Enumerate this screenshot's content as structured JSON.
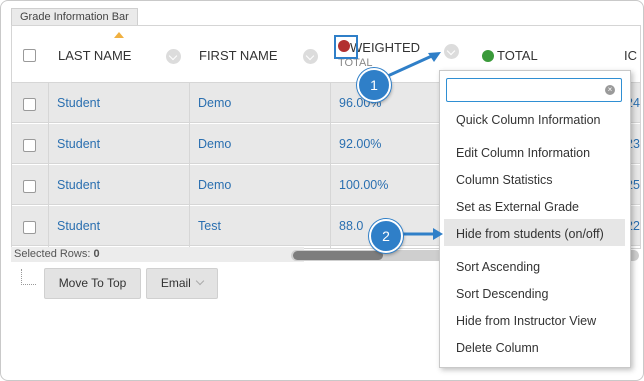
{
  "grade_bar": {
    "title": "Grade Information Bar"
  },
  "columns": {
    "last_name": "LAST NAME",
    "first_name": "FIRST NAME",
    "weighted": "WEIGHTED",
    "weighted_sub": "TOTAL",
    "total": "TOTAL",
    "ic": "IC"
  },
  "rows": [
    {
      "last": "Student",
      "first": "Demo",
      "weighted": "96.00%",
      "ic": "24"
    },
    {
      "last": "Student",
      "first": "Demo",
      "weighted": "92.00%",
      "ic": "23"
    },
    {
      "last": "Student",
      "first": "Demo",
      "weighted": "100.00%",
      "ic": "25"
    },
    {
      "last": "Student",
      "first": "Test",
      "weighted": "88.0",
      "ic": "22"
    }
  ],
  "footer": {
    "selected_label": "Selected Rows:",
    "selected_count": "0",
    "move_to_top": "Move To Top",
    "email": "Email"
  },
  "menu": {
    "items": [
      "Quick Column Information",
      "Edit Column Information",
      "Column Statistics",
      "Set as External Grade",
      "Hide from students (on/off)",
      "Sort Ascending",
      "Sort Descending",
      "Hide from Instructor View",
      "Delete Column"
    ]
  },
  "callouts": {
    "one": "1",
    "two": "2"
  },
  "colors": {
    "link": "#2a6fb0",
    "accent": "#2f7fc8",
    "row_selected": "#e8e8e8"
  }
}
